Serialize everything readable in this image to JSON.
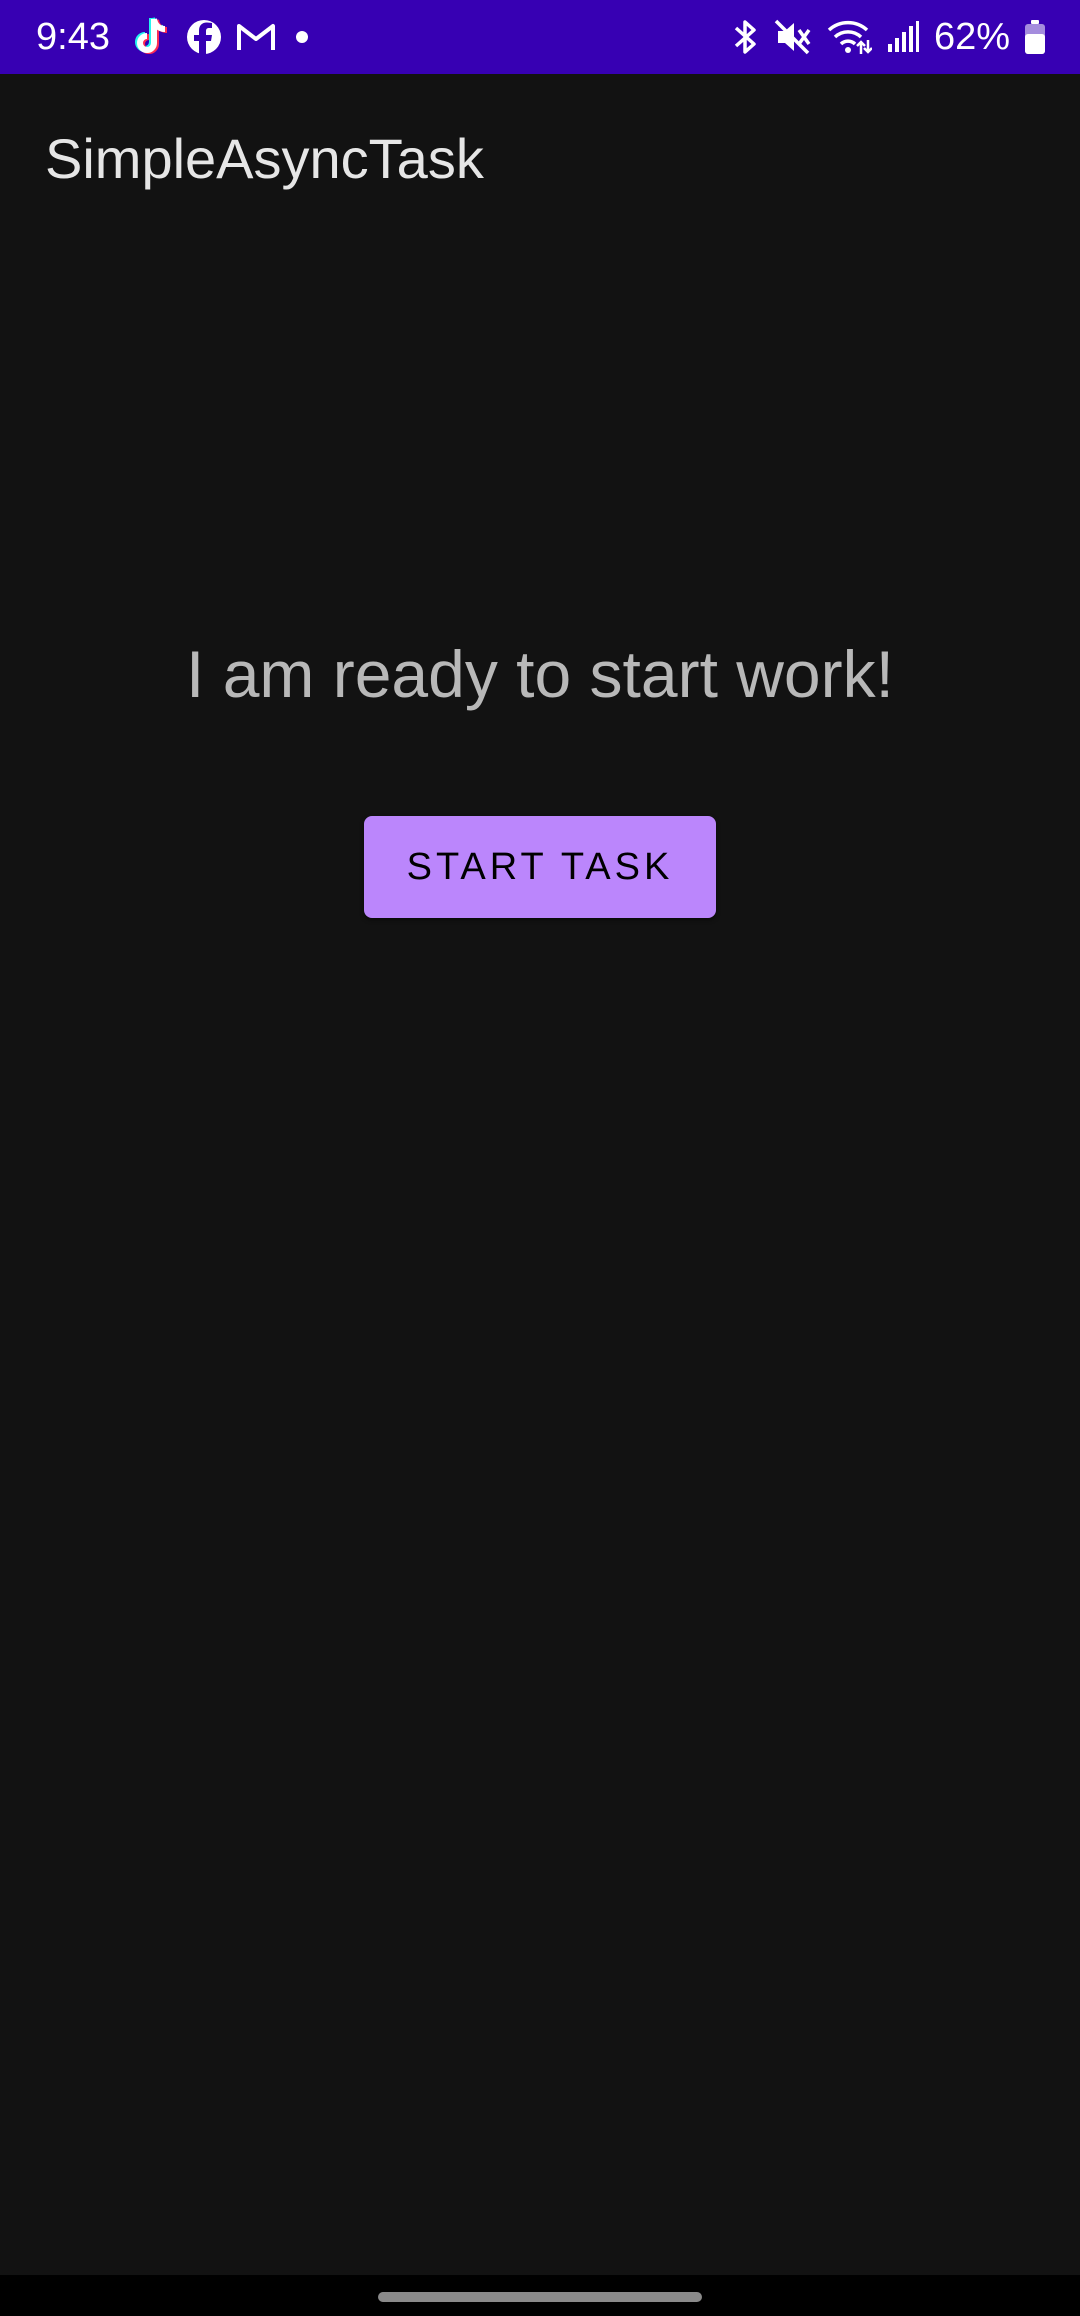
{
  "status_bar": {
    "time": "9:43",
    "battery_percent": "62%",
    "background_color": "#3700b3",
    "left_icons": [
      "tiktok-icon",
      "facebook-icon",
      "gmail-icon",
      "notification-dot-icon"
    ],
    "right_icons": [
      "bluetooth-icon",
      "mute-icon",
      "wifi-icon",
      "signal-icon",
      "battery-icon"
    ]
  },
  "app_bar": {
    "title": "SimpleAsyncTask"
  },
  "main": {
    "status_text": "I am ready to start work!",
    "start_button_label": "START TASK",
    "button_color": "#bb86fc",
    "background_color": "#121212"
  }
}
